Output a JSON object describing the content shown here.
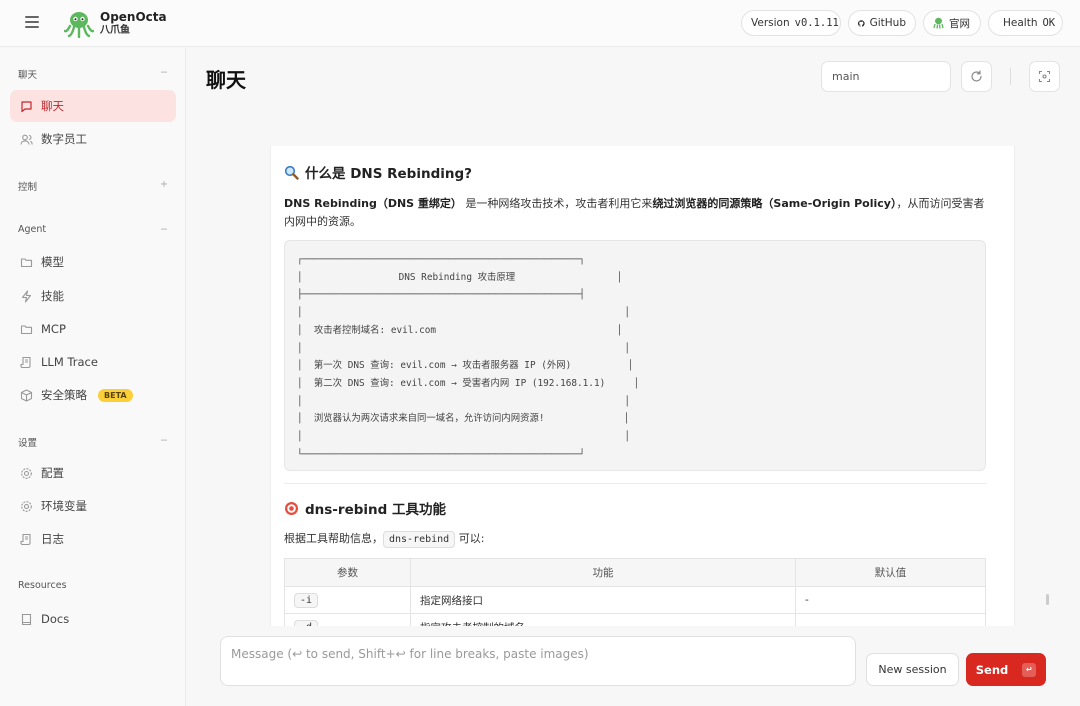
{
  "brand": {
    "name": "OpenOcta",
    "subtitle": "八爪鱼"
  },
  "topbar": {
    "version_label": "Version",
    "version_value": "v0.1.11",
    "github": "GitHub",
    "website": "官网",
    "health_label": "Health",
    "health_value": "OK"
  },
  "sidebar": {
    "sections": [
      {
        "title": "聊天",
        "toggle": "−",
        "items": [
          {
            "label": "聊天",
            "icon": "chat-bubble-icon",
            "active": true
          },
          {
            "label": "数字员工",
            "icon": "users-icon"
          }
        ]
      },
      {
        "title": "控制",
        "toggle": "+",
        "items": []
      },
      {
        "title": "Agent",
        "toggle": "−",
        "items": [
          {
            "label": "模型",
            "icon": "folder-icon"
          },
          {
            "label": "技能",
            "icon": "lightning-icon"
          },
          {
            "label": "MCP",
            "icon": "folder-icon"
          },
          {
            "label": "LLM Trace",
            "icon": "scroll-icon"
          },
          {
            "label": "安全策略",
            "icon": "cube-icon",
            "badge": "BETA"
          }
        ]
      },
      {
        "title": "设置",
        "toggle": "−",
        "items": [
          {
            "label": "配置",
            "icon": "gear-icon"
          },
          {
            "label": "环境变量",
            "icon": "gear-icon"
          },
          {
            "label": "日志",
            "icon": "scroll-icon"
          }
        ]
      },
      {
        "title": "Resources",
        "toggle": "",
        "items": [
          {
            "label": "Docs",
            "icon": "book-icon"
          }
        ]
      }
    ]
  },
  "main": {
    "title": "聊天",
    "session_value": "main"
  },
  "message": {
    "h1": "什么是 DNS Rebinding?",
    "para1_b1": "DNS Rebinding（DNS 重绑定）",
    "para1_t1": "是一种网络攻击技术，攻击者利用它来",
    "para1_b2": "绕过浏览器的同源策略（Same-Origin Policy）",
    "para1_t2": "，从而访问受害者内网中的资源。",
    "code_lines": [
      "┌─────────────────────────────────────────────────┐",
      "│                 DNS Rebinding 攻击原理                  │",
      "├─────────────────────────────────────────────────┤",
      "│                                                         │",
      "│  攻击者控制域名: evil.com                                │",
      "│                                                         │",
      "│  第一次 DNS 查询: evil.com → 攻击者服务器 IP (外网)          │",
      "│  第二次 DNS 查询: evil.com → 受害者内网 IP (192.168.1.1)     │",
      "│                                                         │",
      "│  浏览器认为两次请求来自同一域名，允许访问内网资源!              │",
      "│                                                         │",
      "└─────────────────────────────────────────────────┘"
    ],
    "h2": "dns-rebind 工具功能",
    "para2_pre": "根据工具帮助信息，",
    "para2_code": "dns-rebind",
    "para2_post": "可以:",
    "table_headers": [
      "参数",
      "功能",
      "默认值"
    ],
    "table_rows": [
      {
        "param": "-i",
        "func": "指定网络接口",
        "default": "-"
      },
      {
        "param": "-d",
        "func": "指定攻击者控制的域名",
        "default": "-"
      }
    ]
  },
  "composer": {
    "placeholder": "Message (↩ to send, Shift+↩ for line breaks, paste images)",
    "new_session": "New session",
    "send": "Send",
    "send_key": "↵"
  },
  "colors": {
    "accent": "#d9281f",
    "active_bg": "#fde2e2",
    "health_dot": "#1aa851"
  }
}
